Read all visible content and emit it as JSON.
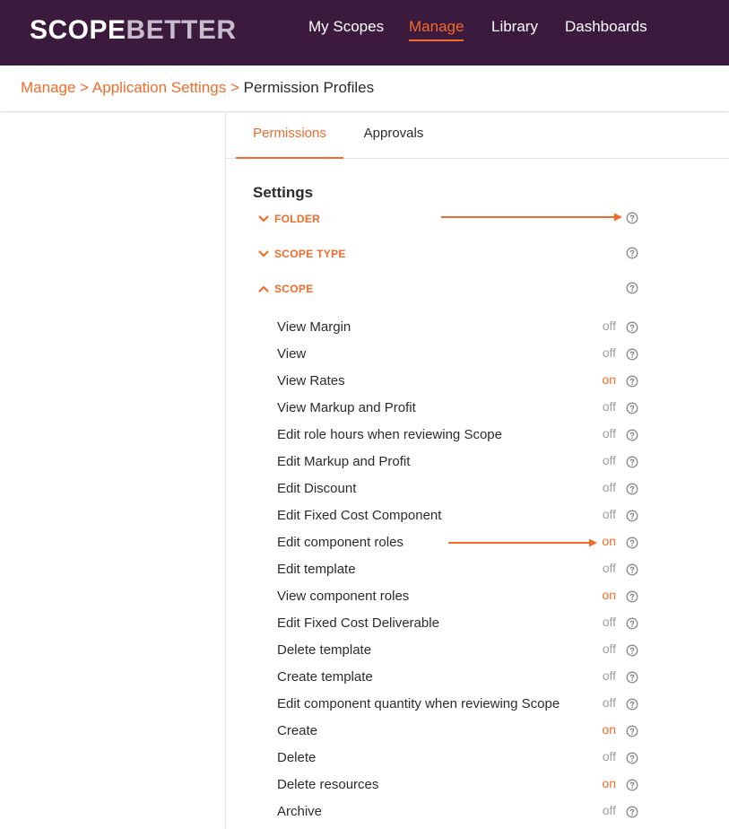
{
  "brand": {
    "logo_part1": "SCOPE",
    "logo_part2": "BETTER"
  },
  "nav": [
    {
      "label": "My Scopes",
      "active": false
    },
    {
      "label": "Manage",
      "active": true
    },
    {
      "label": "Library",
      "active": false
    },
    {
      "label": "Dashboards",
      "active": false
    }
  ],
  "breadcrumb": {
    "items": [
      "Manage",
      "Application Settings"
    ],
    "separator": ">",
    "current": "Permission Profiles"
  },
  "tabs": [
    {
      "label": "Permissions",
      "active": true
    },
    {
      "label": "Approvals",
      "active": false
    }
  ],
  "settings": {
    "title": "Settings",
    "sections": [
      {
        "label": "FOLDER",
        "expanded": false
      },
      {
        "label": "SCOPE TYPE",
        "expanded": false
      },
      {
        "label": "SCOPE",
        "expanded": true
      }
    ],
    "permissions": [
      {
        "label": "View Margin",
        "value": "off"
      },
      {
        "label": "View",
        "value": "off"
      },
      {
        "label": "View Rates",
        "value": "on"
      },
      {
        "label": "View Markup and Profit",
        "value": "off"
      },
      {
        "label": "Edit role hours when reviewing Scope",
        "value": "off"
      },
      {
        "label": "Edit Markup and Profit",
        "value": "off"
      },
      {
        "label": "Edit Discount",
        "value": "off"
      },
      {
        "label": "Edit Fixed Cost Component",
        "value": "off"
      },
      {
        "label": "Edit component roles",
        "value": "on"
      },
      {
        "label": "Edit template",
        "value": "off"
      },
      {
        "label": "View component roles",
        "value": "on"
      },
      {
        "label": "Edit Fixed Cost Deliverable",
        "value": "off"
      },
      {
        "label": "Delete template",
        "value": "off"
      },
      {
        "label": "Create template",
        "value": "off"
      },
      {
        "label": "Edit component quantity when reviewing Scope",
        "value": "off"
      },
      {
        "label": "Create",
        "value": "on"
      },
      {
        "label": "Delete",
        "value": "off"
      },
      {
        "label": "Delete resources",
        "value": "on"
      },
      {
        "label": "Archive",
        "value": "off"
      }
    ]
  },
  "colors": {
    "header_bg": "#3b1a3e",
    "accent": "#f26b2a",
    "off_text": "#a0a0a0",
    "help_icon": "#8a8a8a"
  },
  "icons": {
    "section_collapsed": "chevron-down-icon",
    "section_expanded": "chevron-up-icon",
    "help": "help-circle-icon",
    "annotation": "arrow-right-icon"
  }
}
